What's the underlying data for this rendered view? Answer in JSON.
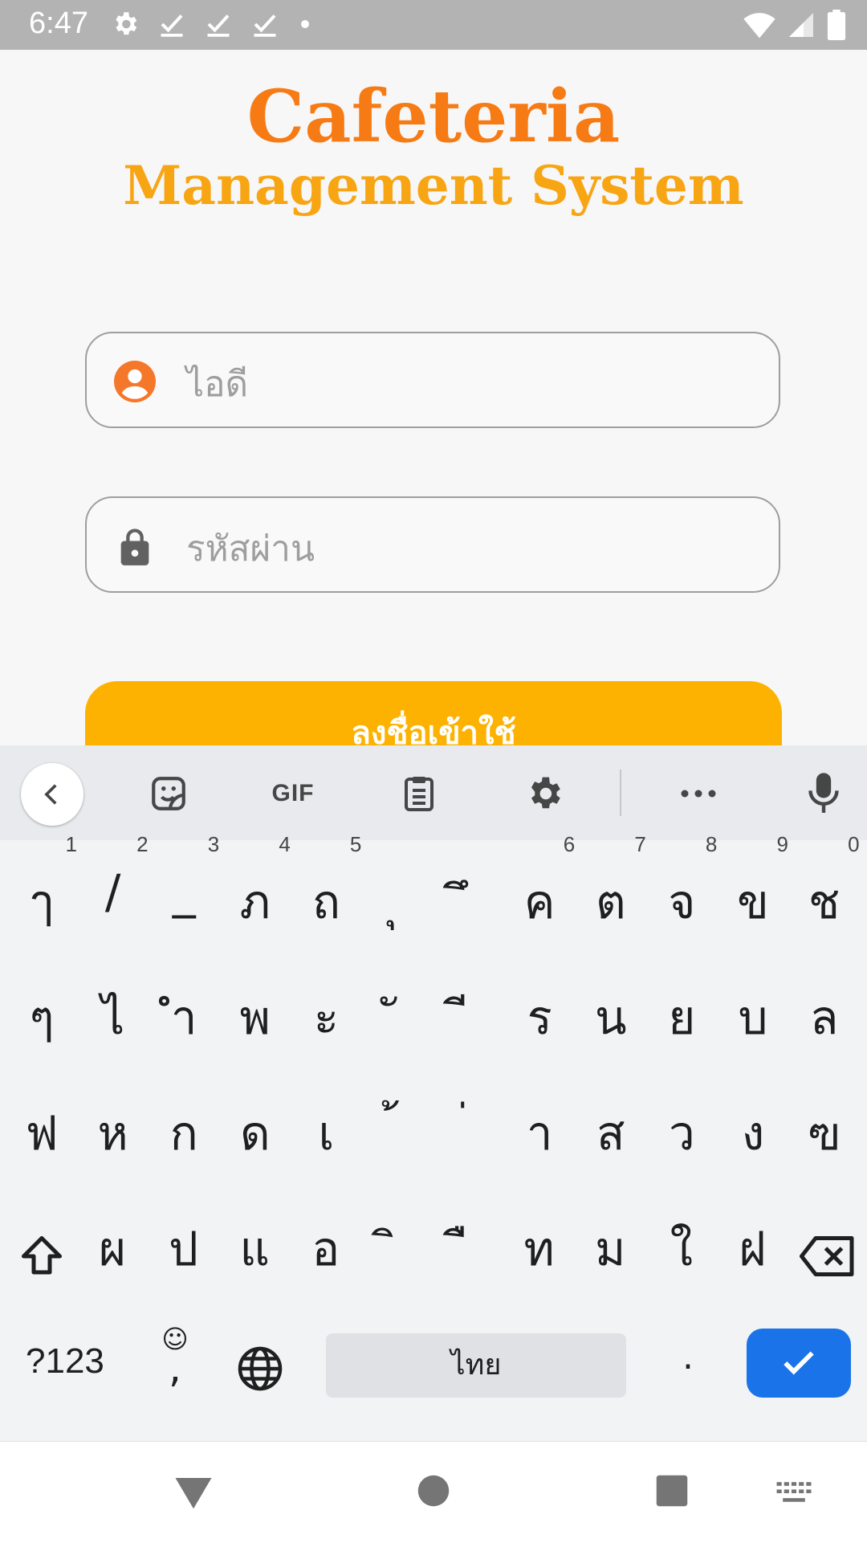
{
  "status_bar": {
    "time": "6:47",
    "left_icons": [
      "gear-icon",
      "check-icon",
      "check-icon",
      "check-icon",
      "dot-icon"
    ],
    "right_icons": [
      "wifi-icon",
      "signal-icon",
      "battery-icon"
    ]
  },
  "app": {
    "title_line1": "Cafeteria",
    "title_line2": "Management System",
    "id_field": {
      "placeholder": "ไอดี",
      "value": "",
      "icon": "account-circle-icon"
    },
    "password_field": {
      "placeholder": "รหัสผ่าน",
      "value": "",
      "icon": "lock-icon"
    },
    "login_button": "ลงชื่อเข้าใช้",
    "colors": {
      "title1": "#f77b14",
      "title2": "#f8a514",
      "button": "#fdb202",
      "icon_orange": "#f5772a"
    }
  },
  "keyboard": {
    "toolbar": {
      "icons": [
        "back-icon",
        "sticker-icon",
        "gif-icon",
        "clipboard-icon",
        "settings-icon",
        "more-icon",
        "mic-icon"
      ],
      "gif_label": "GIF"
    },
    "row1": [
      {
        "c": "ๅ",
        "h": "1"
      },
      {
        "c": "/",
        "h": "2"
      },
      {
        "c": "_",
        "h": "3"
      },
      {
        "c": "ภ",
        "h": "4"
      },
      {
        "c": "ถ",
        "h": "5"
      },
      {
        "c": "ุ",
        "h": ""
      },
      {
        "c": "ึ",
        "h": ""
      },
      {
        "c": "ค",
        "h": "6"
      },
      {
        "c": "ต",
        "h": "7"
      },
      {
        "c": "จ",
        "h": "8"
      },
      {
        "c": "ข",
        "h": "9"
      },
      {
        "c": "ช",
        "h": "0"
      }
    ],
    "row2": [
      {
        "c": "ๆ"
      },
      {
        "c": "ไ"
      },
      {
        "c": "ำ"
      },
      {
        "c": "พ"
      },
      {
        "c": "ะ"
      },
      {
        "c": "ั"
      },
      {
        "c": "ี"
      },
      {
        "c": "ร"
      },
      {
        "c": "น"
      },
      {
        "c": "ย"
      },
      {
        "c": "บ"
      },
      {
        "c": "ล"
      }
    ],
    "row3": [
      {
        "c": "ฟ"
      },
      {
        "c": "ห"
      },
      {
        "c": "ก"
      },
      {
        "c": "ด"
      },
      {
        "c": "เ"
      },
      {
        "c": "้"
      },
      {
        "c": "่"
      },
      {
        "c": "า"
      },
      {
        "c": "ส"
      },
      {
        "c": "ว"
      },
      {
        "c": "ง"
      },
      {
        "c": "ฃ"
      }
    ],
    "row4": [
      {
        "c": "ผ"
      },
      {
        "c": "ป"
      },
      {
        "c": "แ"
      },
      {
        "c": "อ"
      },
      {
        "c": "ิ"
      },
      {
        "c": "ื"
      },
      {
        "c": "ท"
      },
      {
        "c": "ม"
      },
      {
        "c": "ใ"
      },
      {
        "c": "ฝ"
      }
    ],
    "bottom": {
      "symbols_label": "?123",
      "emoji_hint": "☺",
      "comma": ",",
      "space_label": "ไทย",
      "period": "."
    },
    "colors": {
      "enter": "#1a73e8"
    }
  },
  "nav_bar": {
    "icons": [
      "back-triangle-icon",
      "home-circle-icon",
      "recents-square-icon",
      "keyboard-switch-icon"
    ]
  }
}
